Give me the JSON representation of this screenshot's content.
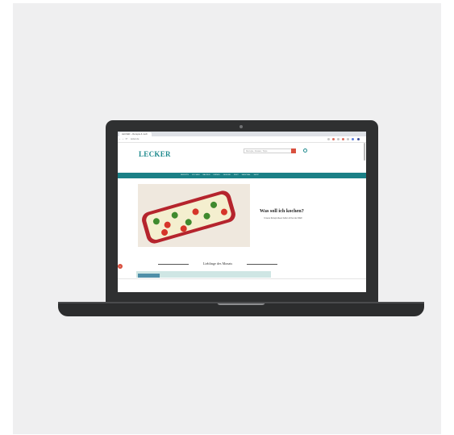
{
  "browser": {
    "tab_title": "LECKER – Rezepte & mehr",
    "url": "lecker.de",
    "nav_buttons": "‹ › ⟳"
  },
  "site": {
    "logo": "LECKER",
    "search_placeholder": "Rezepte, Zutaten, Tipps",
    "nav_items": [
      "REZEPTE",
      "KOCHEN",
      "BACKEN",
      "DRINKS",
      "GESUND",
      "FEST",
      "SAISONAL",
      "SHOP"
    ],
    "hero": {
      "title": "Was soll ich kochen?",
      "subtitle": "Unsere Rezept-Ideen helfen dir bei der Wahl"
    },
    "section_title": "Lieblinge des Monats",
    "badge": "x"
  },
  "colors": {
    "brand": "#1f8a8e",
    "nav_bg": "#1b8086",
    "accent": "#d9503f",
    "laptop": "#2f3031",
    "background": "#efeff0"
  }
}
